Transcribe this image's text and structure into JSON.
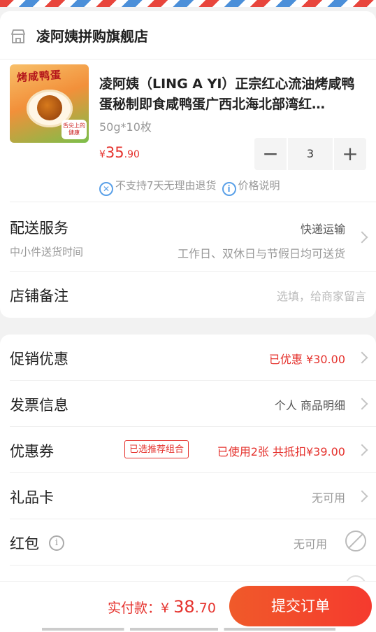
{
  "shop": {
    "name": "凌阿姨拼购旗舰店",
    "icon": "store-icon"
  },
  "product": {
    "image_title": "烤咸鸭蛋",
    "image_badge": "舌尖上的健康",
    "title": "凌阿姨（LING A YI）正宗红心流油烤咸鸭蛋秘制即食咸鸭蛋广西北海北部湾红…",
    "spec": "50g*10枚",
    "price_currency": "¥",
    "price_int": "35",
    "price_dec": ".90",
    "quantity": "3",
    "minus_label": "−",
    "plus_label": "+",
    "no_return_text": "不支持7天无理由退货",
    "price_note_text": "价格说明"
  },
  "delivery": {
    "label": "配送服务",
    "value": "快递运输",
    "sub_label": "中小件送货时间",
    "sub_value": "工作日、双休日与节假日均可送货"
  },
  "remark": {
    "label": "店铺备注",
    "placeholder": "选填，给商家留言"
  },
  "promo": {
    "label": "促销优惠",
    "value": "已优惠 ¥30.00"
  },
  "invoice": {
    "label": "发票信息",
    "value": "个人 商品明细"
  },
  "coupon": {
    "label": "优惠券",
    "tag": "已选推荐组合",
    "value": "已使用2张 共抵扣¥39.00"
  },
  "gift_card": {
    "label": "礼品卡",
    "value": "无可用"
  },
  "red_packet": {
    "label": "红包",
    "value": "无可用"
  },
  "footer": {
    "total_label": "实付款：",
    "currency": "¥ ",
    "amount_int": "38",
    "amount_dec": ".70",
    "submit": "提交订单"
  },
  "colors": {
    "accent": "#e5322d",
    "button": "#f34a2c",
    "info_blue": "#5aa0e8"
  }
}
